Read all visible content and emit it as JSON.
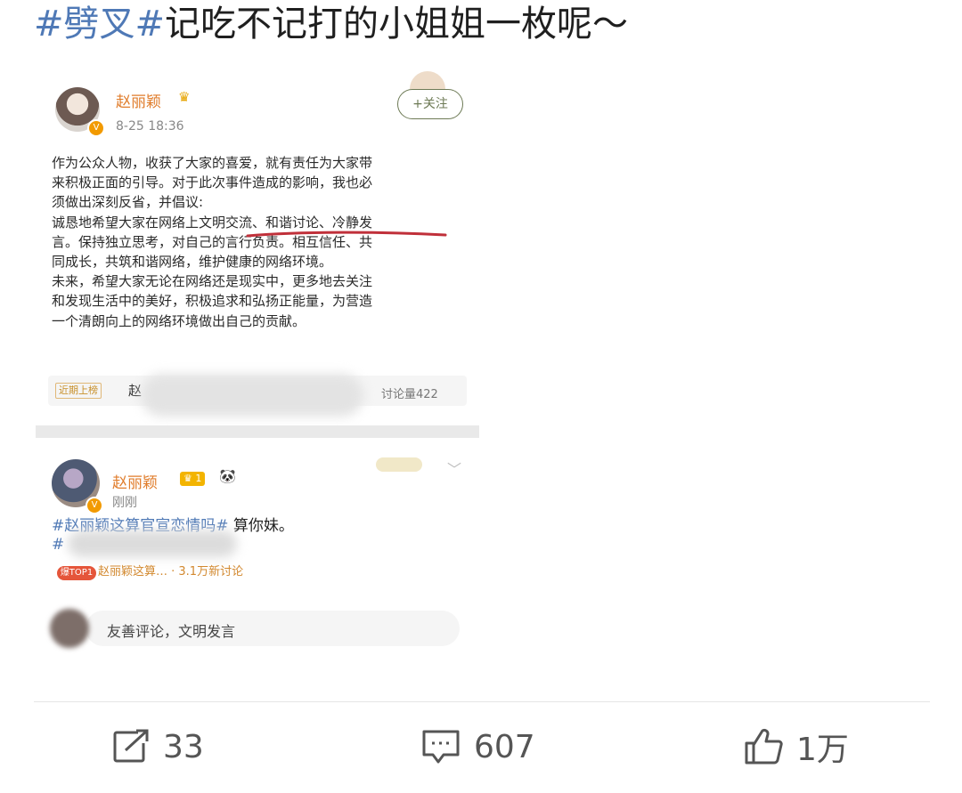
{
  "caption": {
    "tag": "#劈叉#",
    "text": "记吃不记打的小姐姐一枚呢～"
  },
  "post1": {
    "name": "赵丽颖",
    "time": "8-25 18:36",
    "follow": "+关注",
    "lines": [
      "作为公众人物，收获了大家的喜爱，就有责任为大家带",
      "来积极正面的引导。对于此次事件造成的影响，我也必",
      "须做出深刻反省，并倡议:",
      "诚恳地希望大家在网络上文明交流、和谐讨论、冷静发",
      "言。保持独立思考，对自己的言行负责。相互信任、共",
      "同成长，共筑和谐网络，维护健康的网络环境。",
      "未来，希望大家无论在网络还是现实中，更多地去关注",
      "和发现生活中的美好，积极追求和弘扬正能量，为营造",
      "一个清朗向上的网络环境做出自己的贡献。"
    ],
    "hot_tag": "近期上榜",
    "hot_title": "赵",
    "hot_count": "讨论量422"
  },
  "post2": {
    "name": "赵丽颖",
    "level": "1",
    "time": "刚刚",
    "tag": "#赵丽颖这算官宣恋情吗#",
    "text": " 算你妹。",
    "line2": "#",
    "hot_icon": "爆TOP1",
    "hot_text": "赵丽颖这算… · 3.1万新讨论",
    "comment_placeholder": "友善评论，文明发言"
  },
  "actions": {
    "repost_count": "33",
    "comment_count": "607",
    "like_count": "1万"
  },
  "colors": {
    "topic": "#4f79b6",
    "username": "#e07d2c",
    "underline": "#c0303a"
  }
}
